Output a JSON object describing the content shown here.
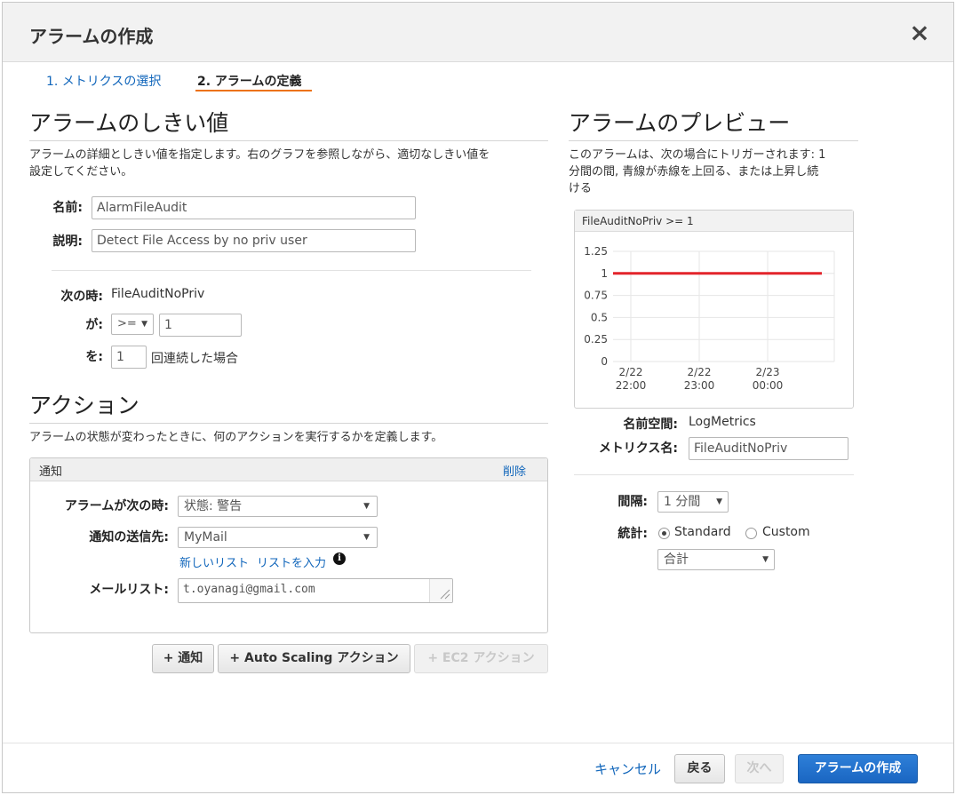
{
  "dialog": {
    "title": "アラームの作成",
    "close_symbol": "×"
  },
  "steps": [
    {
      "label": "1. メトリクスの選択"
    },
    {
      "label": "2. アラームの定義"
    }
  ],
  "threshold": {
    "heading": "アラームのしきい値",
    "description_line1": "アラームの詳細としきい値を指定します。右のグラフを参照しながら、適切なしきい値を",
    "description_line2": "設定してください。",
    "name_label": "名前:",
    "name_value": "AlarmFileAudit",
    "desc_label": "説明:",
    "desc_value": "Detect File Access by no priv user",
    "when_label": "次の時:",
    "when_value": "FileAuditNoPriv",
    "is_label": "が:",
    "operator": ">=",
    "threshold_value": "1",
    "for_label": "を:",
    "periods_value": "1",
    "periods_suffix": "回連続した場合"
  },
  "actions": {
    "heading": "アクション",
    "description": "アラームの状態が変わったときに、何のアクションを実行するかを定義します。",
    "panel_title": "通知",
    "delete_label": "削除",
    "state_label": "アラームが次の時:",
    "state_value": "状態: 警告",
    "send_to_label": "通知の送信先:",
    "send_to_value": "MyMail",
    "new_list_link": "新しいリスト",
    "enter_list_link": "リストを入力",
    "email_list_label": "メールリスト:",
    "email_list_value": "t.oyanagi@gmail.com",
    "add_notification_button": "+ 通知",
    "add_autoscaling_button": "+ Auto Scaling アクション",
    "add_ec2_button": "+ EC2 アクション"
  },
  "preview": {
    "heading": "アラームのプレビュー",
    "description_line1": "このアラームは、次の場合にトリガーされます: 1",
    "description_line2": "分間の間, 青線が赤線を上回る、または上昇し続",
    "description_line3": "ける",
    "chart_title": "FileAuditNoPriv >= 1",
    "namespace_label": "名前空間:",
    "namespace_value": "LogMetrics",
    "metric_name_label": "メトリクス名:",
    "metric_name_value": "FileAuditNoPriv",
    "period_label": "間隔:",
    "period_value": "1 分間",
    "statistic_label": "統計:",
    "standard_label": "Standard",
    "custom_label": "Custom",
    "statistic_value": "合計"
  },
  "chart_data": {
    "type": "line",
    "title": "FileAuditNoPriv >= 1",
    "y_ticks": [
      "1.25",
      "1",
      "0.75",
      "0.5",
      "0.25",
      "0"
    ],
    "ylim": [
      0,
      1.25
    ],
    "x_ticks": [
      {
        "date": "2/22",
        "time": "22:00"
      },
      {
        "date": "2/22",
        "time": "23:00"
      },
      {
        "date": "2/23",
        "time": "00:00"
      }
    ],
    "series": [
      {
        "values": [
          1,
          1
        ],
        "color": "#e3242b"
      }
    ],
    "grid": true
  },
  "footer": {
    "cancel_label": "キャンセル",
    "back_label": "戻る",
    "next_label": "次へ",
    "create_label": "アラームの作成"
  },
  "colors": {
    "accent": "#ec7211",
    "link": "#1166bb",
    "primary": "#1a66c2",
    "threshold_line": "#e3242b"
  }
}
